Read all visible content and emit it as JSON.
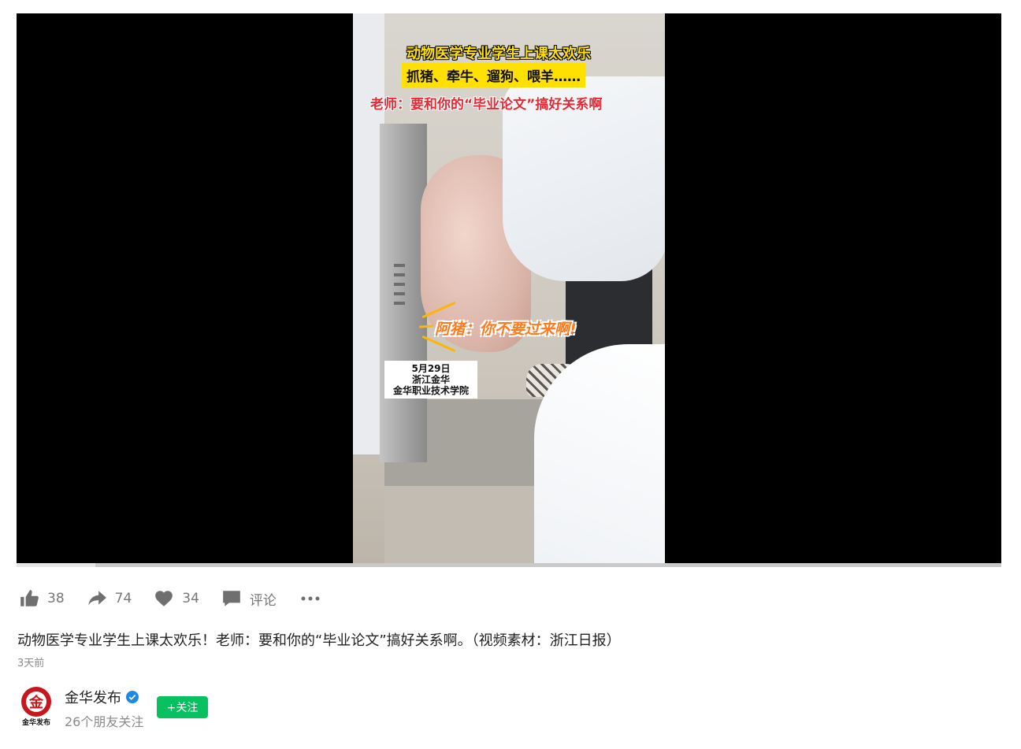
{
  "video": {
    "captions": {
      "title": "动物医学专业学生上课太欢乐",
      "line2": "抓猪、牵牛、遛狗、喂羊……",
      "line3": "老师：要和你的“毕业论文”搞好关系啊",
      "pig_line": "阿猪：你不要过来啊!"
    },
    "date_box": [
      "5月29日",
      "浙江金华",
      "金华职业技术学院"
    ],
    "progress_fraction": 0.08
  },
  "actions": {
    "like": {
      "icon": "thumbs-up-icon",
      "count": "38"
    },
    "share": {
      "icon": "share-arrow-icon",
      "count": "74"
    },
    "favorite": {
      "icon": "heart-icon",
      "count": "34"
    },
    "comment": {
      "icon": "comment-icon",
      "label": "评论"
    },
    "more": {
      "icon": "more-dots-icon"
    }
  },
  "post": {
    "description": "动物医学专业学生上课太欢乐！老师：要和你的“毕业论文”搞好关系啊。（视频素材：浙江日报）",
    "time": "3天前"
  },
  "account": {
    "name": "金华发布",
    "friends_following": "26个朋友关注",
    "follow_label": "+关注",
    "avatar_text": "金华发布",
    "avatar_glyph": "金",
    "verified_icon": "verified-badge-icon"
  },
  "colors": {
    "follow_green": "#07c160",
    "caption_yellow": "#ffe000",
    "caption_red": "#e52a36",
    "brand_red": "#c8161d",
    "verified_blue": "#1e88e5"
  }
}
